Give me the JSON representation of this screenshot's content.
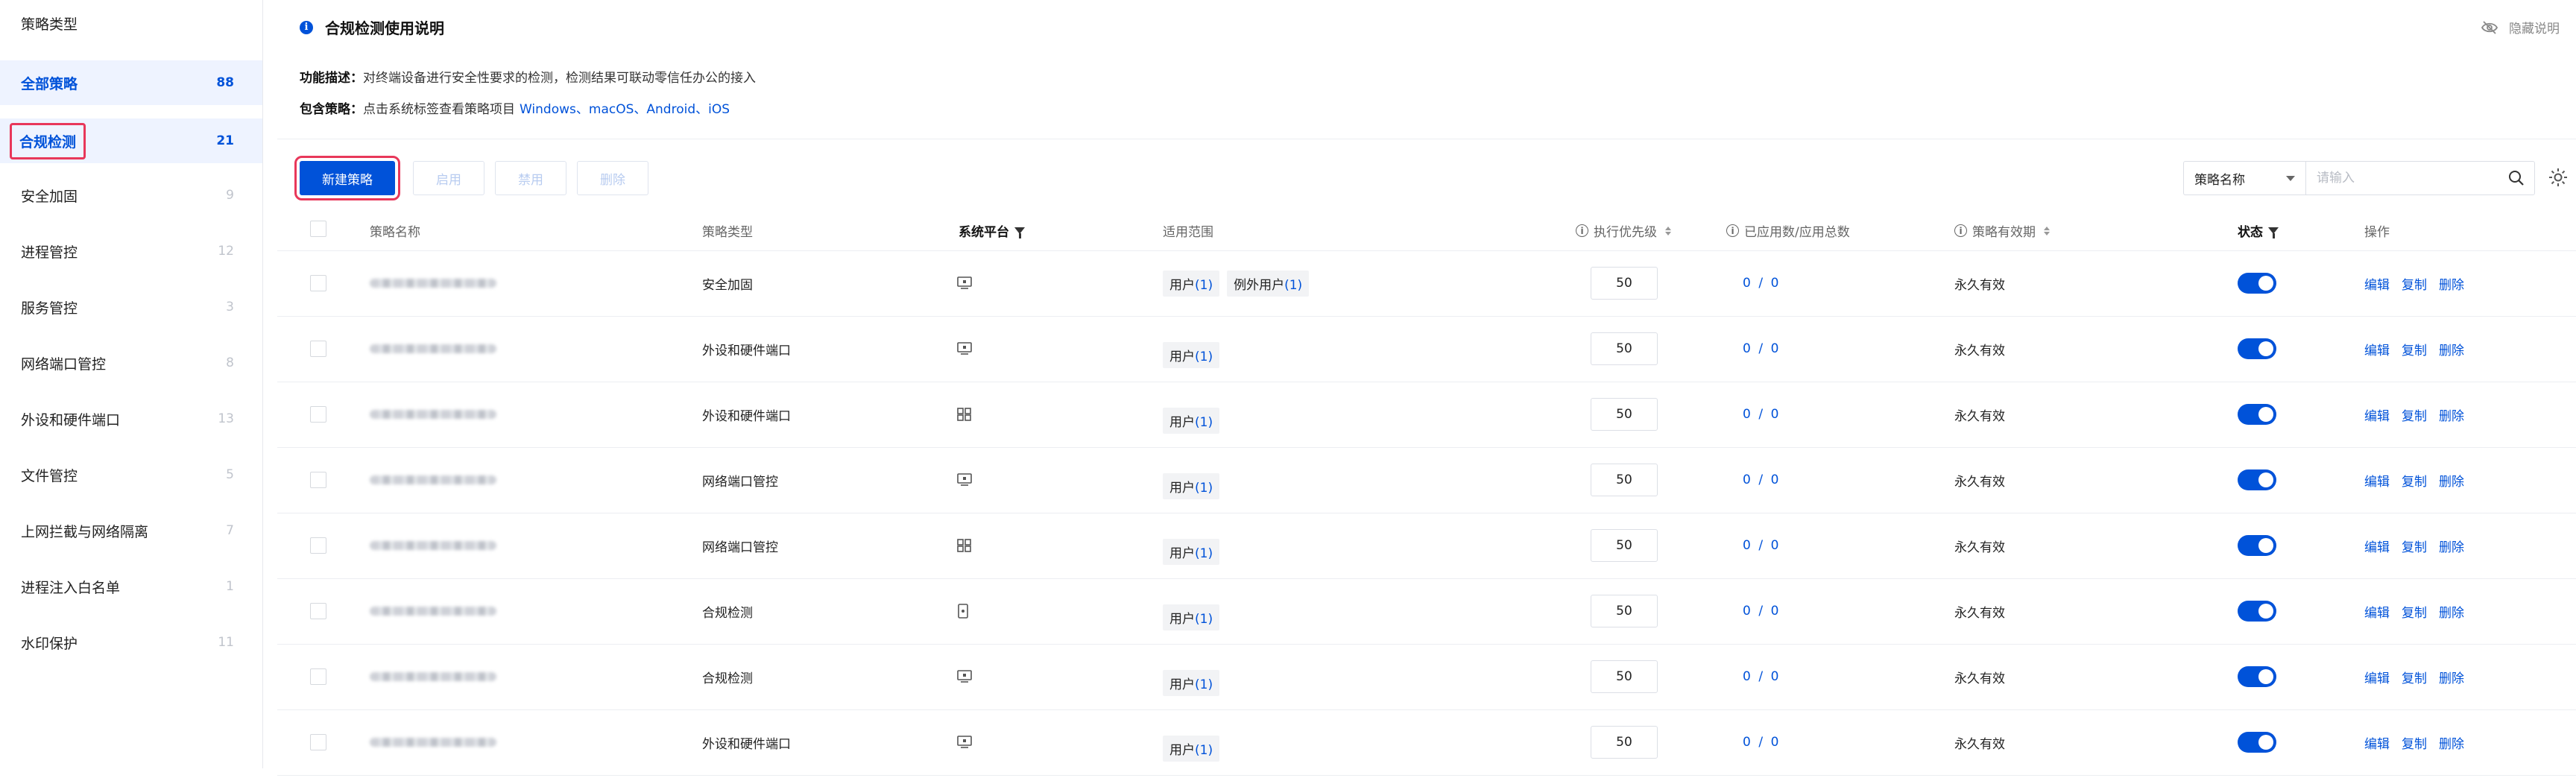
{
  "sidebar": {
    "title": "策略类型",
    "items": [
      {
        "label": "全部策略",
        "count": "88"
      },
      {
        "label": "合规检测",
        "count": "21"
      },
      {
        "label": "安全加固",
        "count": "9"
      },
      {
        "label": "进程管控",
        "count": "12"
      },
      {
        "label": "服务管控",
        "count": "3"
      },
      {
        "label": "网络端口管控",
        "count": "8"
      },
      {
        "label": "外设和硬件端口",
        "count": "13"
      },
      {
        "label": "文件管控",
        "count": "5"
      },
      {
        "label": "上网拦截与网络隔离",
        "count": "7"
      },
      {
        "label": "进程注入白名单",
        "count": "1"
      },
      {
        "label": "水印保护",
        "count": "11"
      }
    ]
  },
  "info": {
    "title": "合规检测使用说明",
    "hide_label": "隐藏说明",
    "desc_label": "功能描述：",
    "desc_text": "对终端设备进行安全性要求的检测，检测结果可联动零信任办公的接入",
    "include_label": "包含策略：",
    "include_text": "点击系统标签查看策略项目",
    "platforms_link": "Windows、macOS、Android、iOS"
  },
  "toolbar": {
    "new_label": "新建策略",
    "enable_label": "启用",
    "disable_label": "禁用",
    "delete_label": "删除",
    "search_field": "策略名称",
    "search_placeholder": "请输入"
  },
  "table": {
    "headers": {
      "name": "策略名称",
      "type": "策略类型",
      "platform": "系统平台",
      "scope": "适用范围",
      "priority": "执行优先级",
      "applied": "已应用数/应用总数",
      "validity": "策略有效期",
      "status": "状态",
      "actions": "操作"
    },
    "scope_user_label": "用户",
    "scope_exception_label": "例外用户",
    "edit_label": "编辑",
    "copy_label": "复制",
    "delete_label": "删除",
    "rows": [
      {
        "type": "安全加固",
        "platform_icon": "monitor-icon",
        "user_count": "(1)",
        "exception_count": "(1)",
        "priority": "50",
        "applied": "0",
        "total": "0",
        "validity": "永久有效",
        "enabled": true
      },
      {
        "type": "外设和硬件端口",
        "platform_icon": "monitor-icon",
        "user_count": "(1)",
        "exception_count": "",
        "priority": "50",
        "applied": "0",
        "total": "0",
        "validity": "永久有效",
        "enabled": true
      },
      {
        "type": "外设和硬件端口",
        "platform_icon": "windows-icon",
        "user_count": "(1)",
        "exception_count": "",
        "priority": "50",
        "applied": "0",
        "total": "0",
        "validity": "永久有效",
        "enabled": true
      },
      {
        "type": "网络端口管控",
        "platform_icon": "monitor-icon",
        "user_count": "(1)",
        "exception_count": "",
        "priority": "50",
        "applied": "0",
        "total": "0",
        "validity": "永久有效",
        "enabled": true
      },
      {
        "type": "网络端口管控",
        "platform_icon": "windows-icon",
        "user_count": "(1)",
        "exception_count": "",
        "priority": "50",
        "applied": "0",
        "total": "0",
        "validity": "永久有效",
        "enabled": true
      },
      {
        "type": "合规检测",
        "platform_icon": "mobile-icon",
        "user_count": "(1)",
        "exception_count": "",
        "priority": "50",
        "applied": "0",
        "total": "0",
        "validity": "永久有效",
        "enabled": true
      },
      {
        "type": "合规检测",
        "platform_icon": "monitor-icon",
        "user_count": "(1)",
        "exception_count": "",
        "priority": "50",
        "applied": "0",
        "total": "0",
        "validity": "永久有效",
        "enabled": true
      },
      {
        "type": "外设和硬件端口",
        "platform_icon": "monitor-icon",
        "user_count": "(1)",
        "exception_count": "",
        "priority": "50",
        "applied": "0",
        "total": "0",
        "validity": "永久有效",
        "enabled": true
      }
    ]
  },
  "colors": {
    "accent": "#0052d9",
    "highlight_border": "#e8375a"
  }
}
